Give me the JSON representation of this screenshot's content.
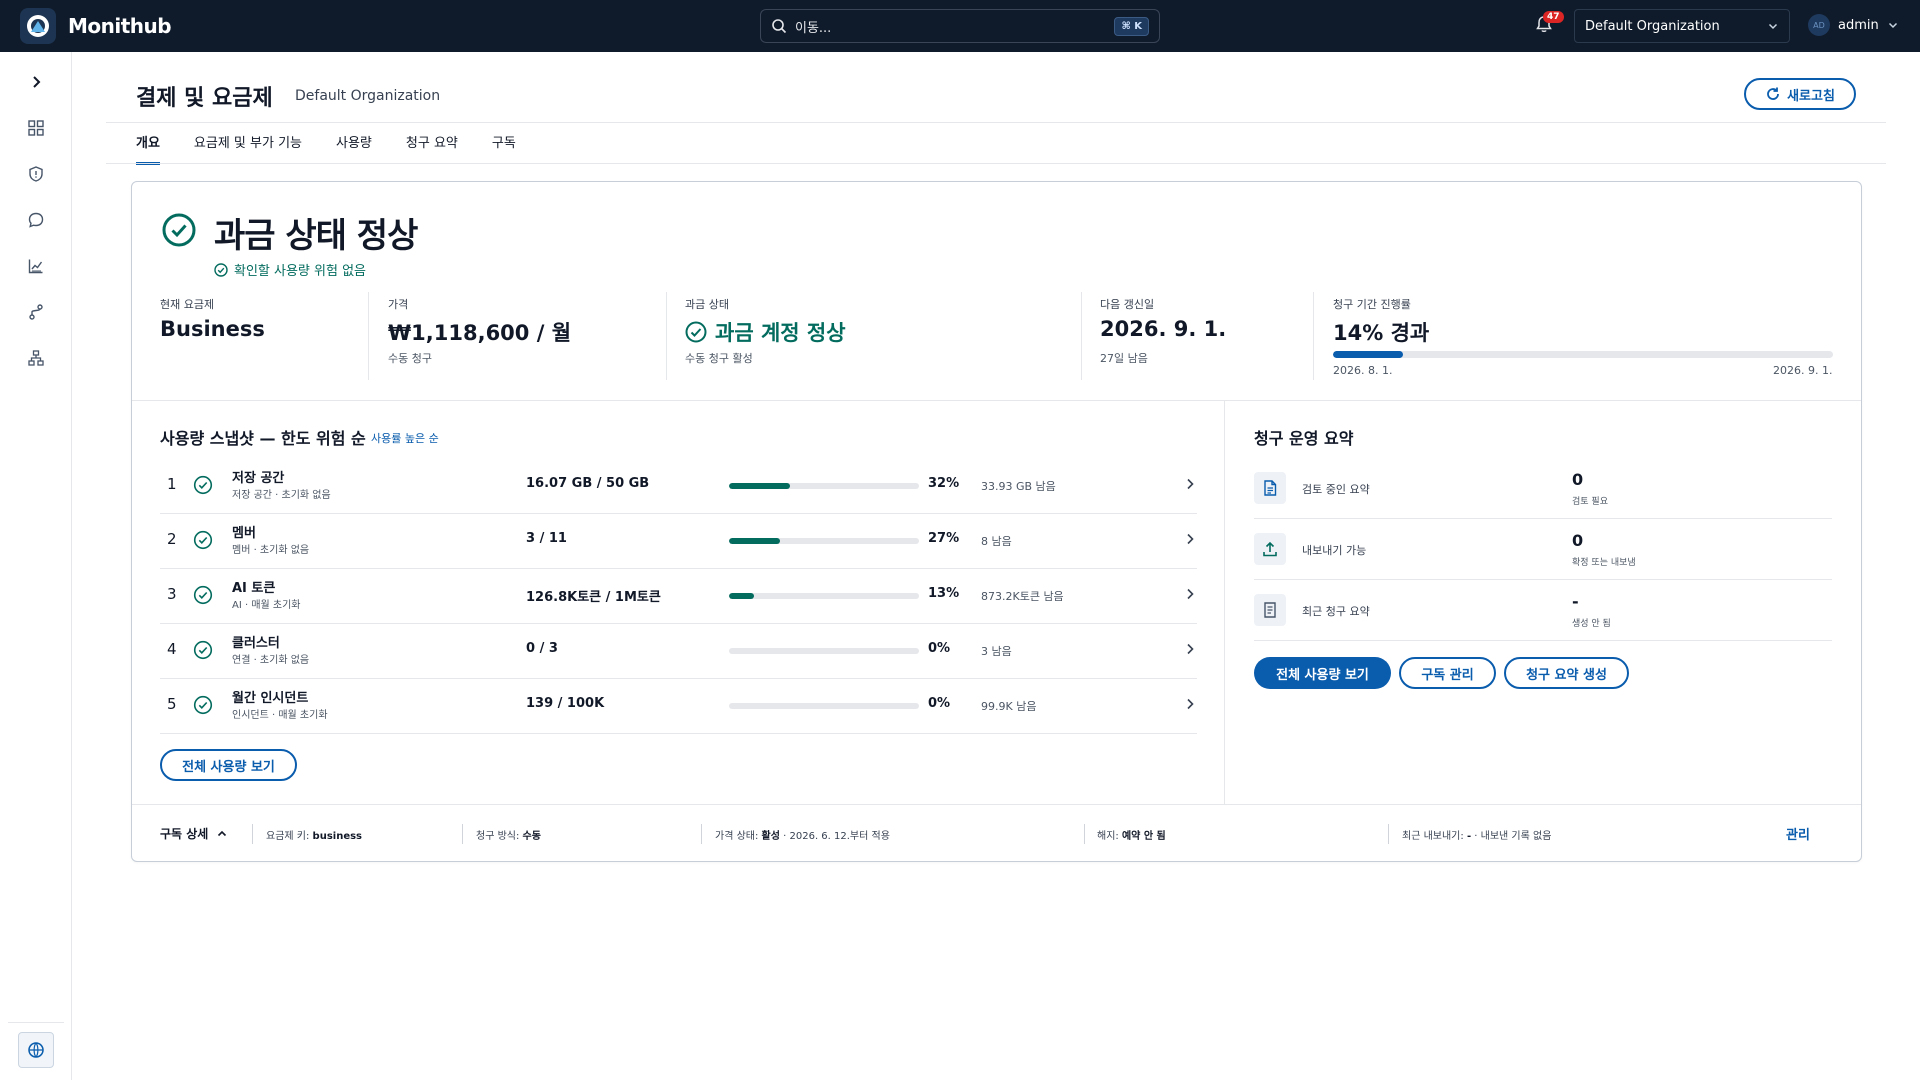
{
  "app": {
    "name": "Monithub"
  },
  "search": {
    "placeholder": "이동...",
    "shortcut": "⌘ K"
  },
  "notifications": {
    "count": "47"
  },
  "org_select": {
    "value": "Default Organization"
  },
  "user": {
    "initials": "AD",
    "name": "admin"
  },
  "page": {
    "title": "결제 및 요금제",
    "subtitle": "Default Organization",
    "refresh_label": "새로고침"
  },
  "tabs": [
    {
      "label": "개요",
      "active": true
    },
    {
      "label": "요금제 및 부가 기능"
    },
    {
      "label": "사용량"
    },
    {
      "label": "청구 요약"
    },
    {
      "label": "구독"
    }
  ],
  "status": {
    "title": "과금 상태 정상",
    "sub": "확인할 사용량 위험 없음",
    "plan": {
      "label": "현재 요금제",
      "value": "Business"
    },
    "price": {
      "label": "가격",
      "value": "₩1,118,600 / 월",
      "note": "수동 청구"
    },
    "billing": {
      "label": "과금 상태",
      "value": "과금 계정 정상",
      "note": "수동 청구 활성"
    },
    "renewal": {
      "label": "다음 갱신일",
      "value": "2026. 9. 1.",
      "note": "27일 남음"
    },
    "period": {
      "label": "청구 기간 진행률",
      "value": "14% 경과",
      "percent": 14,
      "start": "2026. 8. 1.",
      "end": "2026. 9. 1."
    }
  },
  "usage": {
    "title": "사용량 스냅샷 — 한도 위험 순",
    "sort_link": "사용률 높은 순",
    "rows": [
      {
        "idx": "1",
        "name": "저장 공간",
        "sub": "저장 공간 · 초기화 없음",
        "amount": "16.07 GB / 50 GB",
        "percent": 32,
        "pct_label": "32%",
        "remaining": "33.93 GB 남음"
      },
      {
        "idx": "2",
        "name": "멤버",
        "sub": "멤버 · 초기화 없음",
        "amount": "3 / 11",
        "percent": 27,
        "pct_label": "27%",
        "remaining": "8 남음"
      },
      {
        "idx": "3",
        "name": "AI 토큰",
        "sub": "AI · 매월 초기화",
        "amount": "126.8K토큰 / 1M토큰",
        "percent": 13,
        "pct_label": "13%",
        "remaining": "873.2K토큰 남음"
      },
      {
        "idx": "4",
        "name": "클러스터",
        "sub": "연결 · 초기화 없음",
        "amount": "0 / 3",
        "percent": 0,
        "pct_label": "0%",
        "remaining": "3 남음"
      },
      {
        "idx": "5",
        "name": "월간 인시던트",
        "sub": "인시던트 · 매월 초기화",
        "amount": "139 / 100K",
        "percent": 0,
        "pct_label": "0%",
        "remaining": "99.9K 남음"
      }
    ],
    "view_all": "전체 사용량 보기"
  },
  "billing_ops": {
    "title": "청구 운영 요약",
    "rows": [
      {
        "icon": "document-icon",
        "label": "검토 중인 요약",
        "value": "0",
        "note": "검토 필요"
      },
      {
        "icon": "upload-icon",
        "label": "내보내기 가능",
        "value": "0",
        "note": "확정 또는 내보냄"
      },
      {
        "icon": "receipt-icon",
        "label": "최근 청구 요약",
        "value": "-",
        "note": "생성 안 됨"
      }
    ],
    "btn_usage": "전체 사용량 보기",
    "btn_subscription": "구독 관리",
    "btn_generate": "청구 요약 생성"
  },
  "footer": {
    "title": "구독 상세",
    "plan_key_label": "요금제 키:",
    "plan_key": "business",
    "method_label": "청구 방식:",
    "method": "수동",
    "price_status_label": "가격 상태:",
    "price_status": "활성",
    "price_status_note": "· 2026. 6. 12.부터 적용",
    "cancel_label": "해지:",
    "cancel": "예약 안 됨",
    "export_label": "최근 내보내기:",
    "export": "-",
    "export_note": "· 내보낸 기록 없음",
    "manage": "관리"
  },
  "colors": {
    "topbar": "#0f1b2b",
    "accent": "#0a5cad",
    "success": "#046c5f"
  }
}
